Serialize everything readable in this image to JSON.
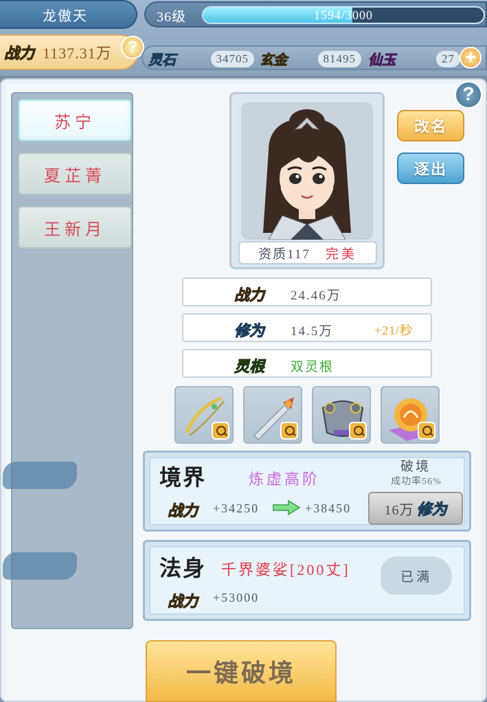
{
  "player": {
    "name": "龙傲天",
    "level": "36级",
    "exp_text": "1594/3000",
    "exp_fraction": 0.531,
    "power_label": "战力",
    "power_value": "1137.31万"
  },
  "resources": [
    {
      "label": "灵石",
      "value": "34705"
    },
    {
      "label": "玄金",
      "value": "81495"
    },
    {
      "label": "仙玉",
      "value": "27"
    }
  ],
  "disciples": [
    {
      "name": "苏宁",
      "active": true
    },
    {
      "name": "夏芷菁",
      "active": false
    },
    {
      "name": "王新月",
      "active": false
    }
  ],
  "portrait": {
    "quality_label": "资质117",
    "quality_grade": "完美"
  },
  "actions": {
    "rename": "改名",
    "expel": "逐出",
    "one_click": "一键破境"
  },
  "stats": {
    "power": {
      "label": "战力",
      "value": "24.46万"
    },
    "cultivation": {
      "label": "修为",
      "value": "14.5万",
      "rate": "+21/秒"
    },
    "root": {
      "label": "灵根",
      "value": "双灵根"
    }
  },
  "equipment": [
    "golden-bow-icon",
    "dagger-icon",
    "armor-icon",
    "phoenix-orb-icon"
  ],
  "realm": {
    "title": "境界",
    "stage": "炼虚高阶",
    "power_label": "战力",
    "power_current": "+34250",
    "power_next": "+38450",
    "break_title": "破境",
    "break_rate": "成功率56%",
    "cost_value": "16万",
    "cost_unit": "修为"
  },
  "body": {
    "title": "法身",
    "name": "千界婆娑[200丈]",
    "power_label": "战力",
    "power_value": "+53000",
    "status": "已满"
  },
  "colors": {
    "accent_gold": "#f3b84a",
    "accent_blue": "#4fa3d2",
    "red_text": "#d94a5a"
  }
}
